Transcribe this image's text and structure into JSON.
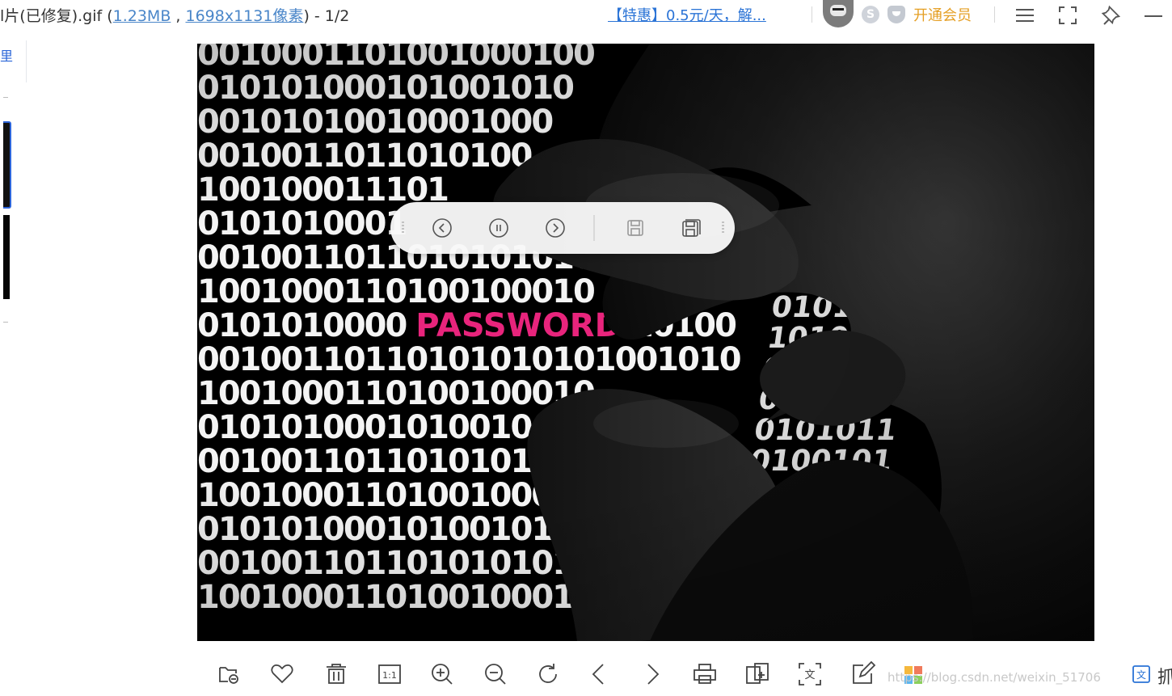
{
  "window": {
    "title_prefix": "l片(已修复).gif (",
    "file_size": "1.23MB",
    "title_sep": " , ",
    "dimensions": "1698x1131像素",
    "title_suffix": ") - 1/2",
    "promo": "【特惠】0.5元/天，解...",
    "coin_label": "S",
    "vip": "开通会员"
  },
  "sidebar": {
    "glyph": "里"
  },
  "image": {
    "rows": [
      "0010001101001000100",
      "010101000101001010",
      "00101010010001000",
      "0010011011010100",
      "100100011101",
      "0101010001",
      "00100110110101010101",
      "1001000110100100010",
      "0101010000",
      "00100110110101010101001010",
      "1001000110100100010",
      "0101010001010010",
      "00100110110101010",
      "100100011010010001",
      "0101010001010010100",
      "00100110110101010101",
      "1001000110100100010001"
    ],
    "pwd_row_lead": "0101010000 ",
    "password": "PASSWORD",
    "pwd_row_tail": " 10100",
    "right_rows": [
      "010",
      "0101",
      "1010",
      "00010001",
      "010",
      "0101011",
      "0100101"
    ]
  },
  "viewer_controls": {
    "prev": "previous",
    "pause": "pause",
    "next": "next",
    "save": "save",
    "save_as": "save-as"
  },
  "footer": {
    "watermark": "https://blog.csdn.net/weixin_51706",
    "cut_glyph": "抓"
  },
  "colors": {
    "accent": "#2a73d6",
    "vip": "#e59f24",
    "password": "#e8247c"
  },
  "icons": [
    "open-folder-icon",
    "heart-icon",
    "trash-icon",
    "actual-size-icon",
    "zoom-in-icon",
    "zoom-out-icon",
    "rotate-icon",
    "prev-arrow-icon",
    "next-arrow-icon",
    "print-icon",
    "convert-icon",
    "ocr-icon",
    "edit-icon"
  ]
}
